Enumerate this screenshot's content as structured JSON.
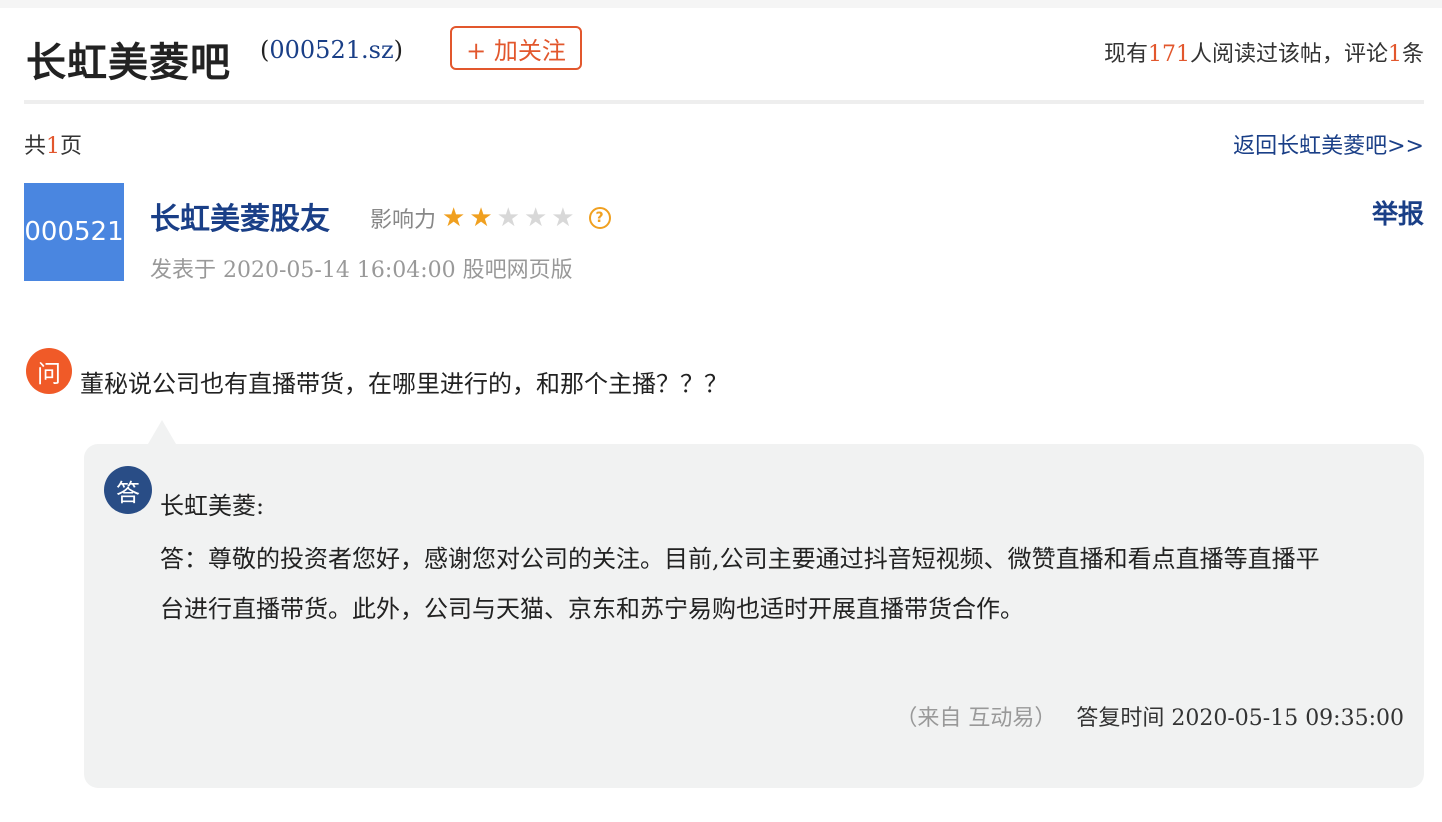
{
  "header": {
    "bar_name": "长虹美菱吧",
    "stock_code_open": "(",
    "stock_code": "000521.sz",
    "stock_code_close": ")",
    "follow_button": "+ 加关注",
    "read_prefix": "现有",
    "read_count": "171",
    "read_middle": "人阅读过该帖，评论",
    "comment_count": "1",
    "read_suffix": "条"
  },
  "pagination": {
    "prefix": "共",
    "count": "1",
    "suffix": "页",
    "back_link": "返回长虹美菱吧>>"
  },
  "post": {
    "avatar_text": "000521",
    "author": "长虹美菱股友",
    "influence_label": "影响力",
    "influence_stars": 2,
    "influence_max": 5,
    "help_icon": "?",
    "meta": "发表于 2020-05-14 16:04:00 股吧网页版",
    "report": "举报"
  },
  "question": {
    "icon_text": "问",
    "text": "董秘说公司也有直播带货，在哪里进行的，和那个主播？？？"
  },
  "answer": {
    "icon_text": "答",
    "company": "长虹美菱:",
    "text": "答：尊敬的投资者您好，感谢您对公司的关注。目前,公司主要通过抖音短视频、微赞直播和看点直播等直播平台进行直播带货。此外，公司与天猫、京东和苏宁易购也适时开展直播带货合作。",
    "source": "（来自 互动易）",
    "reply_time": "答复时间 2020-05-15 09:35:00"
  },
  "colors": {
    "accent": "#e2572d",
    "link": "#1a3f87",
    "star_on": "#f0a020",
    "star_off": "#d8d8d8"
  }
}
